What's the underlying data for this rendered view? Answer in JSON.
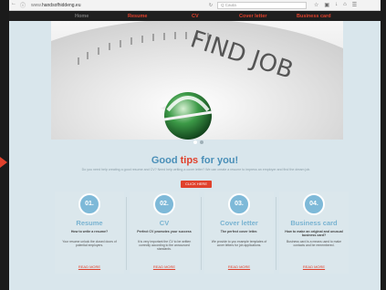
{
  "browser": {
    "url_prefix": "www.",
    "url_domain": "handsofhiddeng.eu",
    "search_placeholder": "Q Cauta",
    "icons": [
      "star-icon",
      "bookmark-icon",
      "download-icon",
      "home-icon",
      "menu-icon"
    ]
  },
  "nav": {
    "items": [
      {
        "label": "Home"
      },
      {
        "label": "Resume"
      },
      {
        "label": "CV"
      },
      {
        "label": "Cover letter"
      },
      {
        "label": "Business card"
      }
    ]
  },
  "hero": {
    "image_text": "FIND JOB"
  },
  "headline": {
    "part1": "Good ",
    "part2": "tips",
    "part3": " for you!",
    "subtitle": "Do you need help creating a good resume and CV? Need help writing a cover letter? We can create a resume to impress an employer and find the dream job.",
    "cta_label": "CLICK HERE"
  },
  "cards": [
    {
      "number": "01.",
      "title": "Resume",
      "subtitle": "How to write a resume?",
      "body": "Your resume unlock the closed doors of potential employers.",
      "link": "READ MORE"
    },
    {
      "number": "02.",
      "title": "CV",
      "subtitle": "Perfect CV promotes your success",
      "body": "It is very important the CV to be written correctly according to the announced standards.",
      "link": "READ MORE"
    },
    {
      "number": "03.",
      "title": "Cover letter",
      "subtitle": "The perfect cover letter.",
      "body": "We provide to you example templates of cover letters for job applications.",
      "link": "READ MORE"
    },
    {
      "number": "04.",
      "title": "Business card",
      "subtitle": "How to make an original and unusual business card?",
      "body": "Business card is a means used to make contacts and be remembered.",
      "link": "READ MORE"
    }
  ],
  "colors": {
    "accent_red": "#e0412c",
    "accent_blue": "#4a8fb8",
    "badge_blue": "#7eb9d8"
  }
}
